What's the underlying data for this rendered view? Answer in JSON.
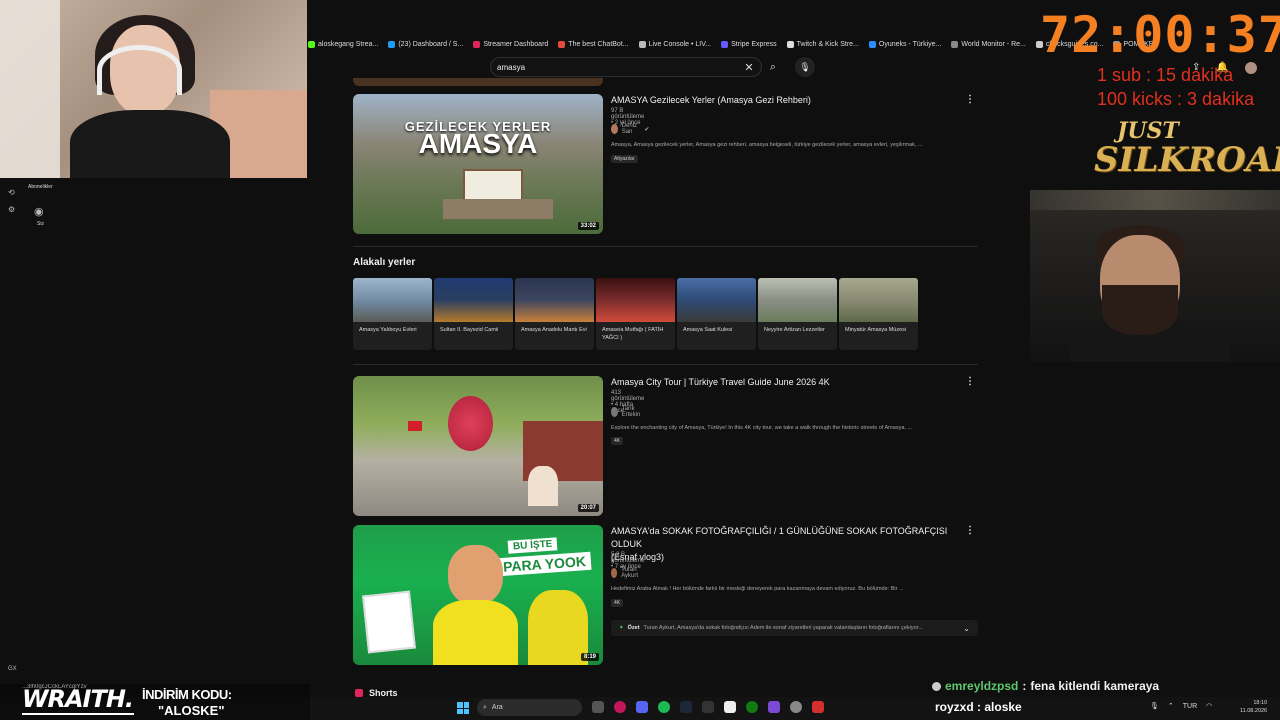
{
  "bookmarks": [
    {
      "label": "aloskegang Strea..."
    },
    {
      "label": "(23) Dashboard / S..."
    },
    {
      "label": "Streamer Dashboard"
    },
    {
      "label": "The best ChatBot..."
    },
    {
      "label": "Live Console • LIV..."
    },
    {
      "label": "Stripe Express"
    },
    {
      "label": "Twitch & Kick Stre..."
    },
    {
      "label": "Oyuneks - Türkiye..."
    },
    {
      "label": "World Monitor - Re..."
    },
    {
      "label": "chucksguides.co..."
    },
    {
      "label": "POMAKER"
    }
  ],
  "search": {
    "value": "amasya"
  },
  "sidebar": {
    "subscriptions_label": "Abonelikler",
    "you_label": "Siz"
  },
  "results": [
    {
      "title": "AMASYA Gezilecek Yerler (Amasya Gezi Rehberi)",
      "meta": "97 B görüntüleme • 2 yıl önce",
      "channel": "Deniz San",
      "desc": "Amasya, Amasya gezilecek yerler, Amasya gezi rehberi, amasya belgeseli, türkiye gezilecek yerler, amasya evleri, yeşilırmak, ...",
      "badge": "Altyazılar",
      "duration": "33:02",
      "thumb_text": [
        "GEZİLECEK YERLER",
        "AMASYA"
      ]
    },
    {
      "title": "Amasya City Tour | Türkiye Travel Guide June 2026 4K",
      "meta": "413 görüntüleme • 4 hafta önce",
      "channel": "Tarık Ertekin",
      "desc": "Explore the enchanting city of Amasya, Türkiye! In this 4K city tour, we take a walk through the historic streets of Amasya, ...",
      "badge": "4K",
      "duration": "20:07"
    },
    {
      "title_line1": "AMASYA'da SOKAK FOTOĞRAFÇILIĞI / 1 GÜNLÜĞÜNE SOKAK FOTOĞRAFÇISI OLDUK",
      "title_line2": "(Esnaf vlog3)",
      "meta": "5,2 B görüntüleme • 7 ay önce",
      "channel": "Turan Aykurt",
      "desc": "Hedefimiz Araba Almak ! Her bölümde farklı bir mesleği deneyerek para kazanmaya devam ediyoruz. Bu bölümde: Bir ...",
      "badge": "4K",
      "duration": "8:19",
      "thumb_text": [
        "BU İŞTE",
        "PARA YOOK"
      ],
      "summary_label": "Özet",
      "summary_text": "Turan Aykurt, Amasya'da sokak fotoğrafçısı Adem ile esnaf ziyaretleri yaparak vatandaşların fotoğraflarını çekiyor..."
    }
  ],
  "related": {
    "title": "Alakalı yerler",
    "places": [
      {
        "name": "Amasya Yalıboyu Evleri",
        "color": "#6f87a0"
      },
      {
        "name": "Sultan II. Bayezid Camii",
        "color": "#2b3f63"
      },
      {
        "name": "Amasya Anadolu Mantı Evi",
        "color": "#3d4660"
      },
      {
        "name": "Amaseia Mutfağı ( FATİH YAĞCI )",
        "color": "#7a2d2d"
      },
      {
        "name": "Amasya Saat Kulesi",
        "color": "#2f4b76"
      },
      {
        "name": "Neyyire Artizan Lezzetler",
        "color": "#8a8f86"
      },
      {
        "name": "Minyatür Amasya Müzesi",
        "color": "#8b8b74"
      }
    ]
  },
  "shorts": {
    "label": "Shorts"
  },
  "overlay": {
    "timer": "72:00:37",
    "sub_rate": "1 sub : 15 dakika",
    "kick_rate": "100 kicks : 3 dakika",
    "logo_line1": "JUST",
    "logo_line2": "SILKROAD",
    "timer_color": "#f58021",
    "rate_color": "#e0301e"
  },
  "chat": [
    {
      "user": "emreyldzpsd",
      "message": "fena kitlendi kameraya"
    },
    {
      "user": "royzxd",
      "message": "aloske"
    }
  ],
  "promo": {
    "brand": "WRAITH.",
    "label": "İNDİRİM KODU:",
    "code": "\"ALOSKE\"",
    "url": "...3lh0gcJCckLAYcqlYzv"
  },
  "taskbar": {
    "search_placeholder": "Ara",
    "language": "TUR",
    "time": "18:10",
    "date": "11.08.2026"
  }
}
